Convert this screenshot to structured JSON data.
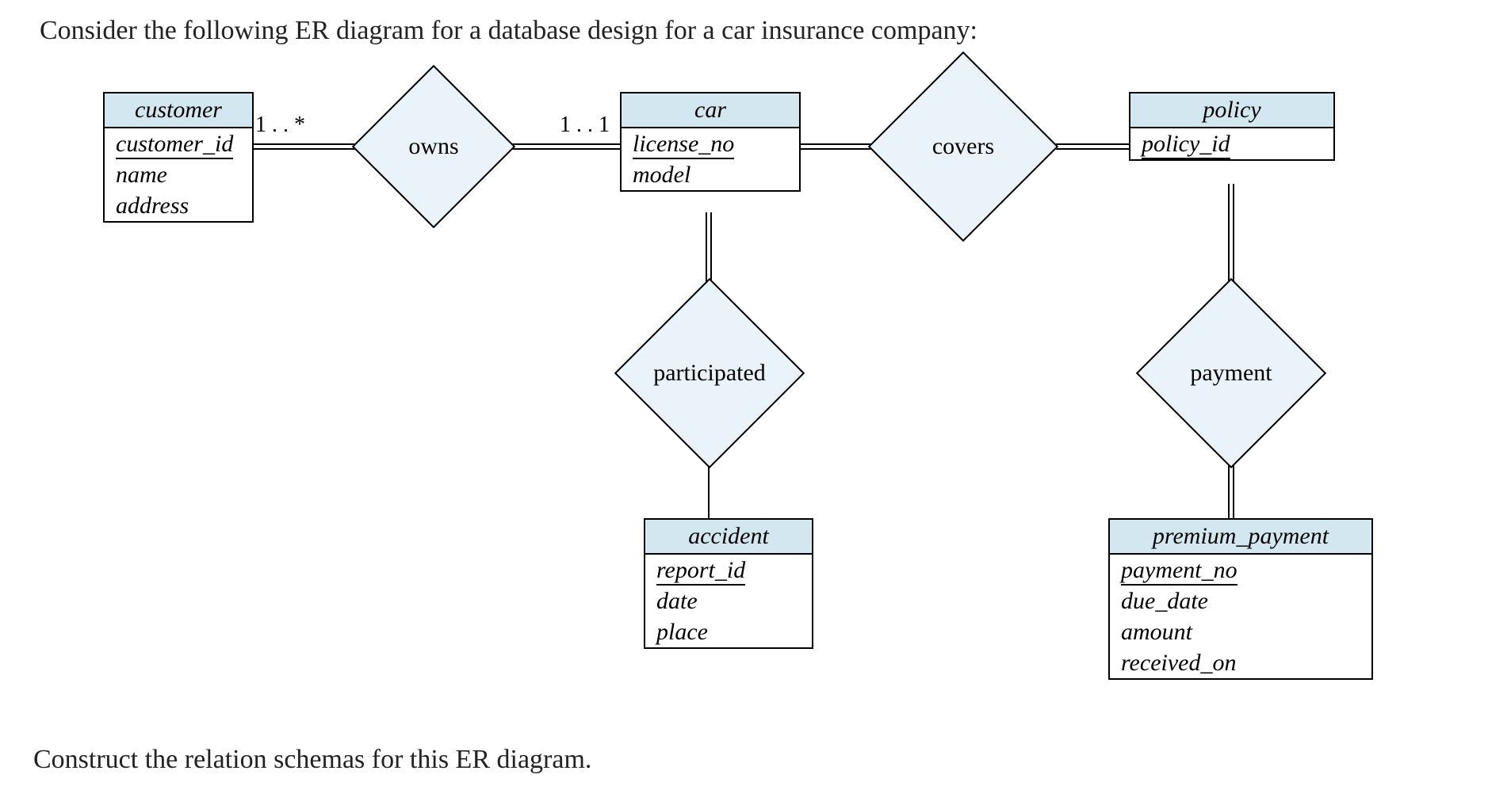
{
  "question_top": "Consider the following ER diagram for a database design for a car insurance company:",
  "question_bottom": "Construct the relation schemas for this ER diagram.",
  "entities": {
    "customer": {
      "title": "customer",
      "attrs": [
        "customer_id",
        "name",
        "address"
      ],
      "pk": [
        "customer_id"
      ]
    },
    "car": {
      "title": "car",
      "attrs": [
        "license_no",
        "model"
      ],
      "pk": [
        "license_no"
      ]
    },
    "policy": {
      "title": "policy",
      "attrs": [
        "policy_id"
      ],
      "pk": [
        "policy_id"
      ]
    },
    "accident": {
      "title": "accident",
      "attrs": [
        "report_id",
        "date",
        "place"
      ],
      "pk": [
        "report_id"
      ]
    },
    "premium_payment": {
      "title": "premium_payment",
      "attrs": [
        "payment_no",
        "due_date",
        "amount",
        "received_on"
      ],
      "pk": [
        "payment_no"
      ]
    }
  },
  "relationships": {
    "owns": "owns",
    "covers": "covers",
    "participated": "participated",
    "payment": "payment"
  },
  "cardinalities": {
    "customer_owns": "1 . . *",
    "owns_car": "1 . . 1"
  }
}
